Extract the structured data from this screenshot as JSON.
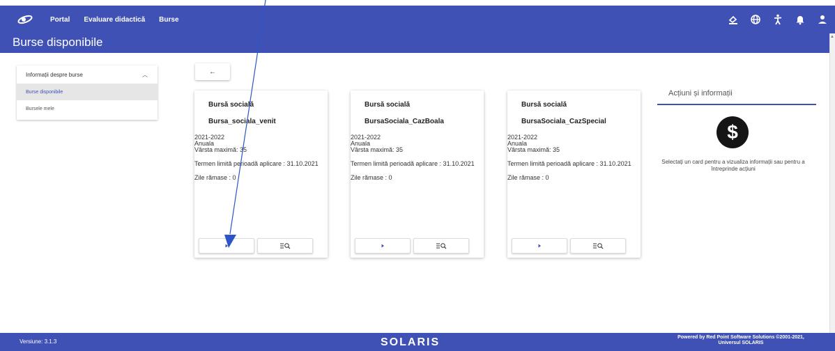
{
  "navbar": {
    "logo_icon": "solaris-logo-icon",
    "items": [
      {
        "label": "Portal"
      },
      {
        "label": "Evaluare didactică"
      },
      {
        "label": "Burse"
      }
    ],
    "icons": [
      "accessibility-color-icon",
      "globe-icon",
      "accessibility-person-icon",
      "bell-icon",
      "user-icon"
    ]
  },
  "page": {
    "title": "Burse disponibile"
  },
  "sidebar": {
    "header": "Informații despre burse",
    "items": [
      {
        "label": "Burse disponibile",
        "active": true
      },
      {
        "label": "Bursele mele",
        "active": false
      }
    ]
  },
  "back_button": {
    "label": "←"
  },
  "cards": [
    {
      "type": "Bursă socială",
      "name": "Bursa_sociala_venit",
      "year": "2021-2022",
      "period_type": "Anuala",
      "max_age": "Vârsta maximă: 35",
      "deadline": "Termen limită perioadă aplicare : 31.10.2021",
      "days_left": "Zile rămase : 0"
    },
    {
      "type": "Bursă socială",
      "name": "BursaSociala_CazBoala",
      "year": "2021-2022",
      "period_type": "Anuala",
      "max_age": "Vârsta maximă: 35",
      "deadline": "Termen limită perioadă aplicare : 31.10.2021",
      "days_left": "Zile rămase : 0"
    },
    {
      "type": "Bursă socială",
      "name": "BursaSociala_CazSpecial",
      "year": "2021-2022",
      "period_type": "Anuala",
      "max_age": "Vârsta maximă: 35",
      "deadline": "Termen limită perioadă aplicare : 31.10.2021",
      "days_left": "Zile rămase : 0"
    }
  ],
  "info_panel": {
    "title": "Acțiuni și informații",
    "icon": "dollar-icon",
    "text": "Selectați un card pentru a vizualiza informații sau pentru a întreprinde acțiuni"
  },
  "footer": {
    "version": "Versiune: 3.1.3",
    "brand": "SOLARIS",
    "powered_line1": "Powered by Red Point Software Solutions ©2001-2021,",
    "powered_line2": "Universul SOLARIS"
  },
  "colors": {
    "primary": "#3f51b5",
    "annotation": "#2b55c9"
  }
}
